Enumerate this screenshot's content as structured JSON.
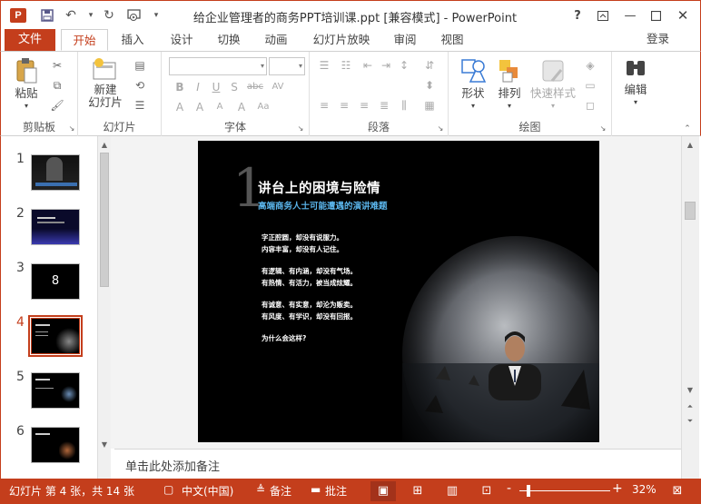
{
  "app": {
    "window_title": "给企业管理者的商务PPT培训课.ppt [兼容模式] - PowerPoint",
    "app_icon_letter": "P",
    "accent": "#c43e1c"
  },
  "tabs": {
    "file": "文件",
    "items": [
      "开始",
      "插入",
      "设计",
      "切换",
      "动画",
      "幻灯片放映",
      "审阅",
      "视图"
    ],
    "active": "开始",
    "login": "登录"
  },
  "ribbon": {
    "clipboard": {
      "label": "剪贴板",
      "paste": "粘贴"
    },
    "slides": {
      "label": "幻灯片",
      "new_slide_line1": "新建",
      "new_slide_line2": "幻灯片"
    },
    "font": {
      "label": "字体",
      "font_name": "",
      "font_size": ""
    },
    "paragraph": {
      "label": "段落"
    },
    "drawing": {
      "label": "绘图",
      "shapes": "形状",
      "arrange": "排列",
      "quick_styles": "快速样式"
    },
    "editing": {
      "label": "编辑",
      "edit": "编辑"
    }
  },
  "thumbnails": {
    "numbers": [
      "1",
      "2",
      "3",
      "4",
      "5",
      "6"
    ],
    "current": "4",
    "slide3_text": "8"
  },
  "slide": {
    "number_glyph": "1",
    "title": "讲台上的困境与险情",
    "subtitle": "高端商务人士可能遭遇的演讲难题",
    "lines": [
      "字正腔圆，却没有说服力。",
      "内容丰富，却没有人记住。",
      "有逻辑、有内涵，却没有气场。",
      "有热情、有活力，被当成炫耀。",
      "有诚意、有实意，却沦为贩卖。",
      "有风度、有学识，却没有回报。",
      "为什么会这样?"
    ]
  },
  "notes": {
    "placeholder": "单击此处添加备注"
  },
  "status": {
    "slide_info": "幻灯片 第 4 张，共 14 张",
    "language": "中文(中国)",
    "notes_btn": "备注",
    "comments_btn": "批注",
    "zoom_minus": "-",
    "zoom_plus": "+",
    "zoom": "32%"
  }
}
